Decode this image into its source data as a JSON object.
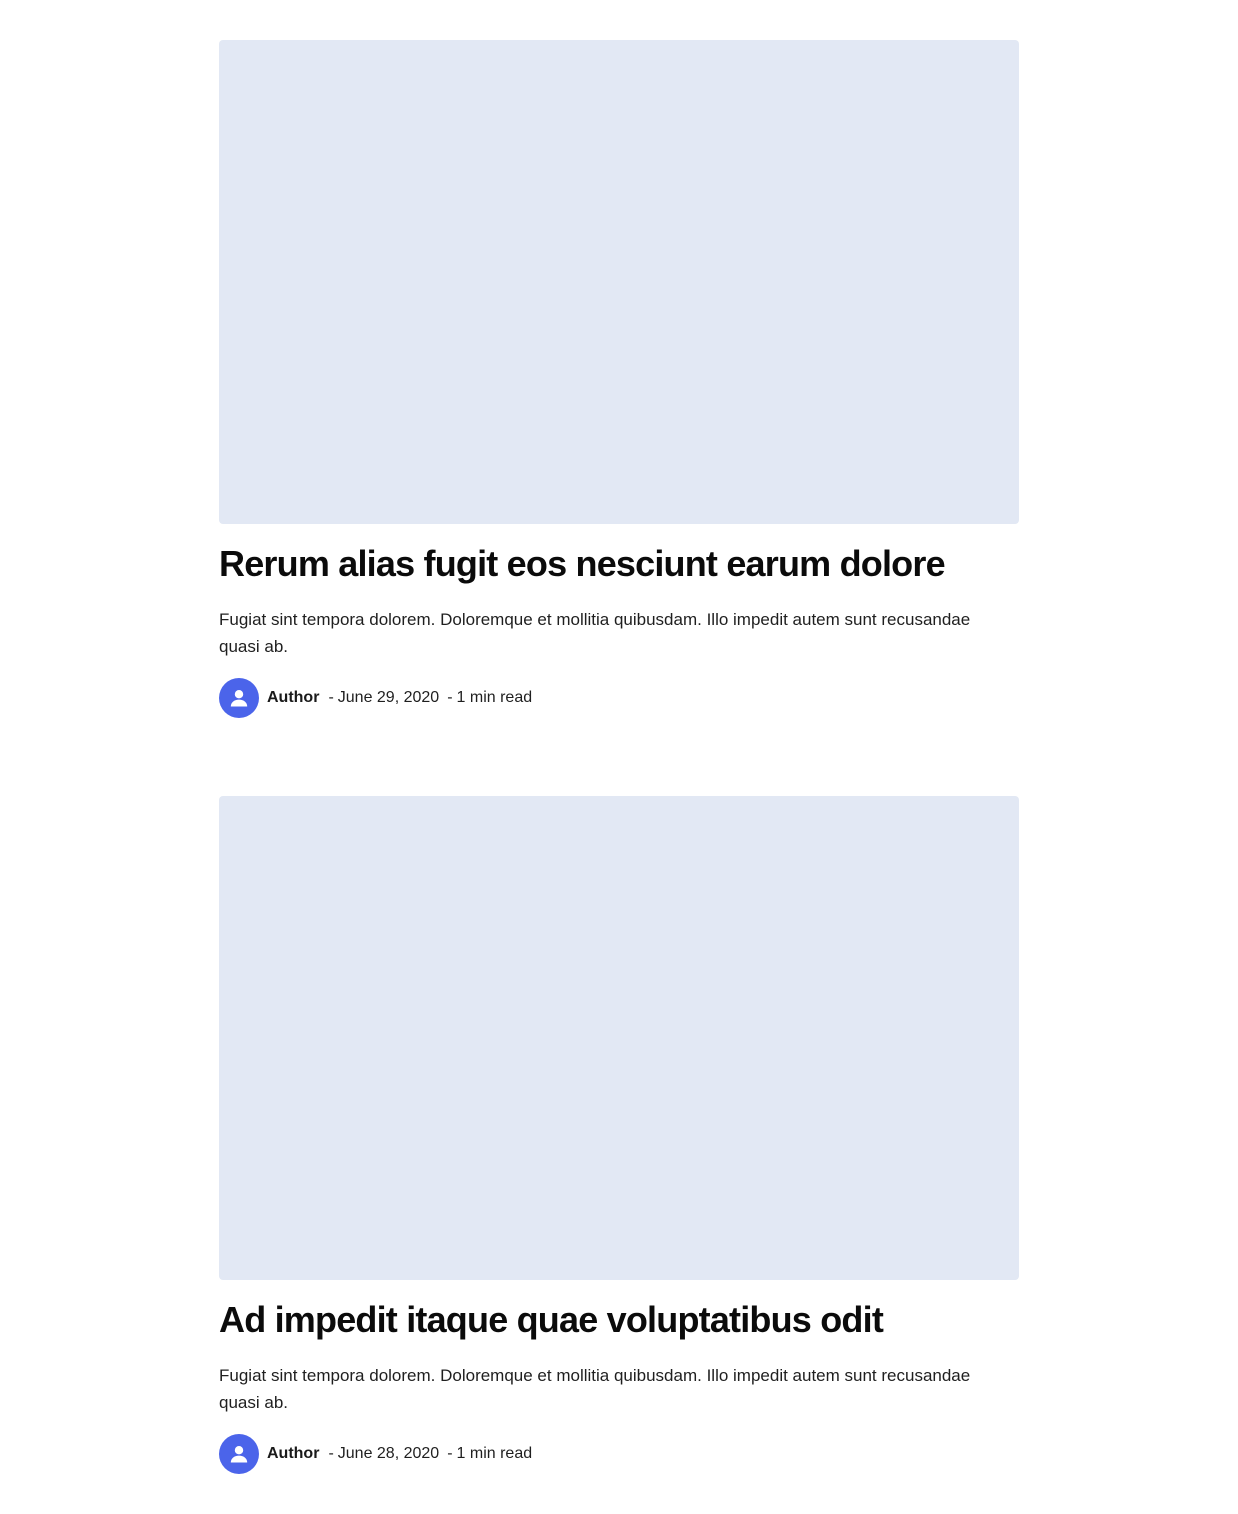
{
  "colors": {
    "image_placeholder": "#e2e8f4",
    "avatar_background": "#4b64ea",
    "title_text": "#0b0b0b"
  },
  "icons": {
    "avatar": "user-icon"
  },
  "posts": [
    {
      "title": "Rerum alias fugit eos nesciunt earum dolore",
      "excerpt": "Fugiat sint tempora dolorem. Doloremque et mollitia quibusdam. Illo impedit autem sunt recusandae quasi ab.",
      "author": "Author",
      "separator": "-",
      "date": "June 29, 2020",
      "read_time": "1 min read"
    },
    {
      "title": "Ad impedit itaque quae voluptatibus odit",
      "excerpt": "Fugiat sint tempora dolorem. Doloremque et mollitia quibusdam. Illo impedit autem sunt recusandae quasi ab.",
      "author": "Author",
      "separator": "-",
      "date": "June 28, 2020",
      "read_time": "1 min read"
    }
  ]
}
